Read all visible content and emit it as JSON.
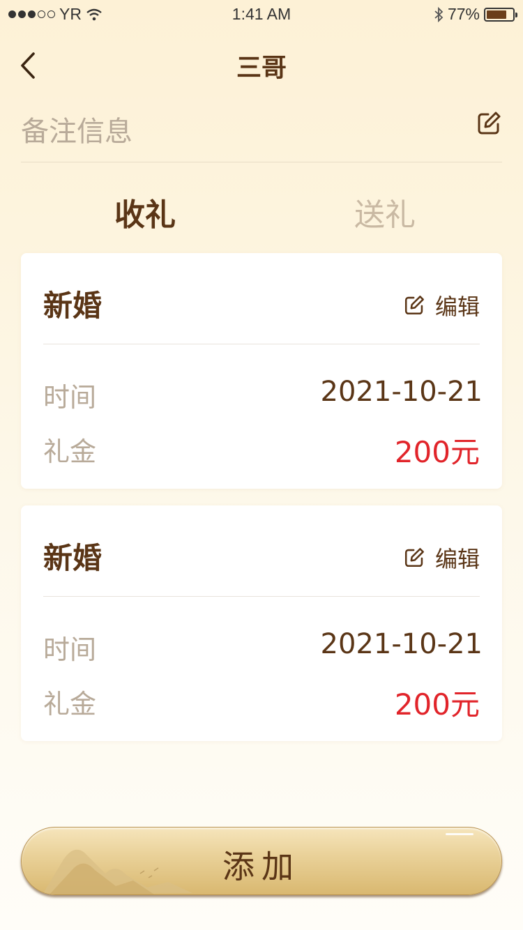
{
  "status_bar": {
    "carrier": "YR",
    "time": "1:41 AM",
    "battery_text": "77%",
    "battery_level": 0.77
  },
  "header": {
    "title": "三哥"
  },
  "note": {
    "placeholder": "备注信息"
  },
  "tabs": [
    {
      "label": "收礼",
      "active": true
    },
    {
      "label": "送礼",
      "active": false
    }
  ],
  "records": [
    {
      "title": "新婚",
      "edit_label": "编辑",
      "time_label": "时间",
      "time_value": "2021-10-21",
      "amount_label": "礼金",
      "amount_value": "200元"
    },
    {
      "title": "新婚",
      "edit_label": "编辑",
      "time_label": "时间",
      "time_value": "2021-10-21",
      "amount_label": "礼金",
      "amount_value": "200元"
    }
  ],
  "add_button": {
    "label": "添加"
  },
  "colors": {
    "brand_brown": "#5a3516",
    "amount_red": "#e1242a",
    "muted_text": "#b8aa99",
    "button_gold": "#ead29a"
  }
}
